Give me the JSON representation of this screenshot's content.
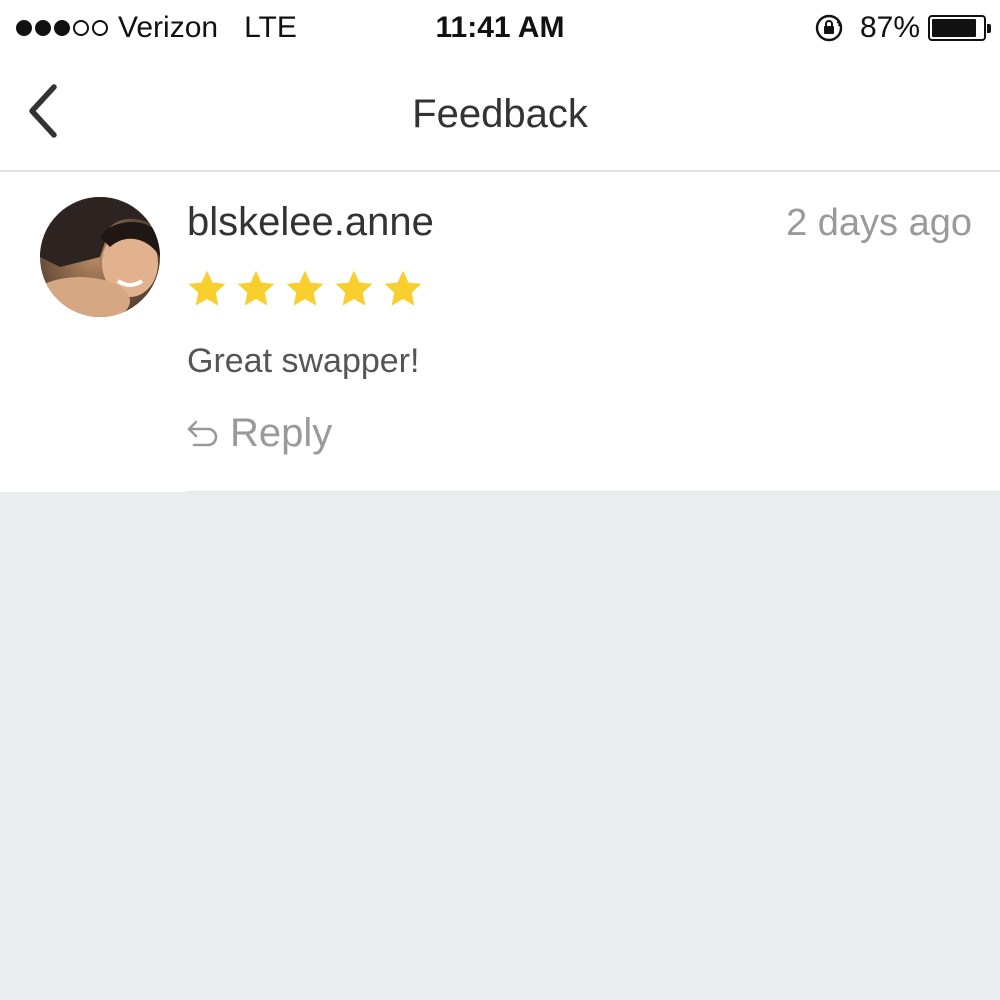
{
  "status_bar": {
    "signal_bars_filled": 3,
    "signal_bars_total": 5,
    "carrier": "Verizon",
    "network": "LTE",
    "time": "11:41 AM",
    "lock_icon": "orientation-lock-icon",
    "battery_percent": "87%",
    "battery_level": 0.87
  },
  "nav": {
    "back_icon": "chevron-left-icon",
    "title": "Feedback"
  },
  "feedback": [
    {
      "username": "blskelee.anne",
      "time_ago": "2 days ago",
      "rating": 5,
      "rating_max": 5,
      "star_color": "#f9cf2f",
      "comment": "Great swapper!",
      "reply_icon": "reply-arrow-icon",
      "reply_label": "Reply"
    }
  ],
  "colors": {
    "background": "#ebecee",
    "card": "#ffffff",
    "muted_text": "#9a9a9a",
    "primary_text": "#333333"
  }
}
